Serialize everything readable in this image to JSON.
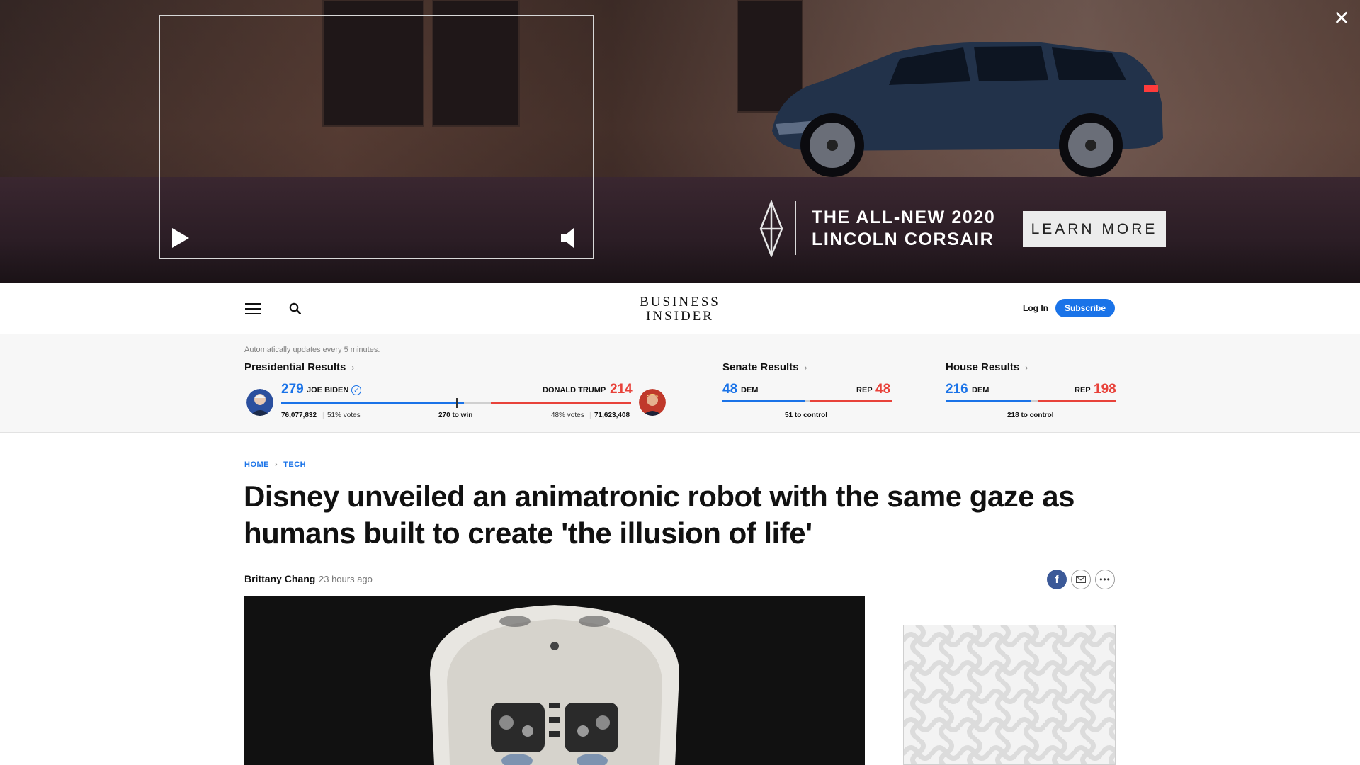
{
  "ad": {
    "headline_line1": "THE ALL-NEW 2020",
    "headline_line2": "LINCOLN CORSAIR",
    "cta_label": "LEARN MORE",
    "close_glyph": "✕"
  },
  "header": {
    "logo_line1": "BUSINESS",
    "logo_line2": "INSIDER",
    "login_label": "Log In",
    "subscribe_label": "Subscribe"
  },
  "election": {
    "auto_update_note": "Automatically updates every 5 minutes.",
    "presidential": {
      "title": "Presidential Results",
      "dem": {
        "electoral": "279",
        "name": "JOE BIDEN",
        "votes": "76,077,832",
        "pct": "51% votes"
      },
      "rep": {
        "electoral": "214",
        "name": "DONALD TRUMP",
        "votes": "71,623,408",
        "pct": "48% votes"
      },
      "threshold_label": "270 to win"
    },
    "senate": {
      "title": "Senate Results",
      "dem_seats": "48",
      "dem_label": "DEM",
      "rep_seats": "48",
      "rep_label": "REP",
      "threshold_label": "51 to control"
    },
    "house": {
      "title": "House Results",
      "dem_seats": "216",
      "dem_label": "DEM",
      "rep_seats": "198",
      "rep_label": "REP",
      "threshold_label": "218 to control"
    }
  },
  "article": {
    "breadcrumb": [
      "HOME",
      "TECH"
    ],
    "headline": "Disney unveiled an animatronic robot with the same gaze as humans built to create 'the illusion of life'",
    "author": "Brittany Chang",
    "time_ago": "23 hours ago"
  },
  "colors": {
    "dem": "#1a73e8",
    "rep": "#e8423a",
    "subscribe": "#1a73e8",
    "facebook": "#3b5998"
  }
}
